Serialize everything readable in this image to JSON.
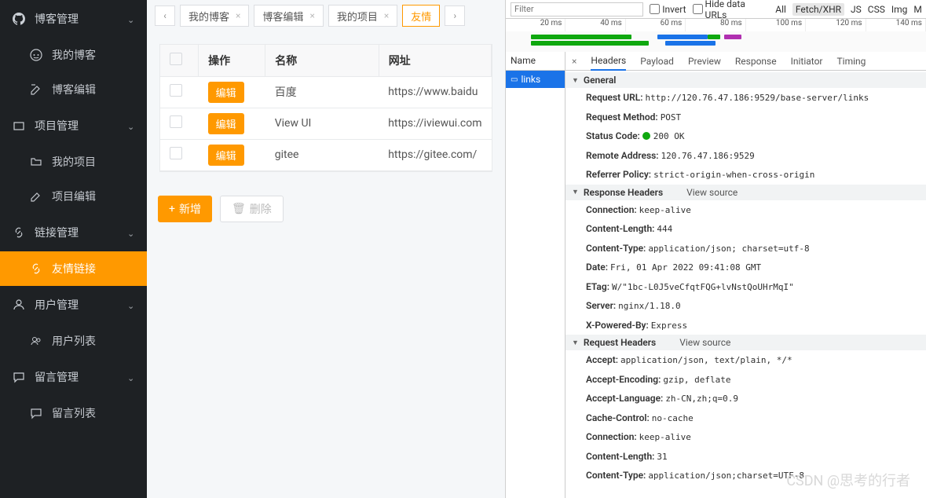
{
  "sidebar": {
    "groups": [
      {
        "label": "博客管理",
        "items": [
          {
            "label": "我的博客"
          },
          {
            "label": "博客编辑"
          }
        ]
      },
      {
        "label": "项目管理",
        "items": [
          {
            "label": "我的项目"
          },
          {
            "label": "项目编辑"
          }
        ]
      },
      {
        "label": "链接管理",
        "items": [
          {
            "label": "友情链接",
            "active": true
          }
        ]
      },
      {
        "label": "用户管理",
        "items": [
          {
            "label": "用户列表"
          }
        ]
      },
      {
        "label": "留言管理",
        "items": [
          {
            "label": "留言列表"
          }
        ]
      }
    ]
  },
  "tabs": {
    "prev": "‹",
    "next": "›",
    "items": [
      {
        "label": "我的博客",
        "close": "×"
      },
      {
        "label": "博客编辑",
        "close": "×"
      },
      {
        "label": "我的项目",
        "close": "×"
      },
      {
        "label": "友情",
        "close": "",
        "active": true
      }
    ]
  },
  "table": {
    "headers": {
      "op": "操作",
      "name": "名称",
      "url": "网址"
    },
    "edit_label": "编辑",
    "rows": [
      {
        "name": "百度",
        "url": "https://www.baidu"
      },
      {
        "name": "View UI",
        "url": "https://iviewui.com"
      },
      {
        "name": "gitee",
        "url": "https://gitee.com/"
      }
    ]
  },
  "buttons": {
    "add": "新增",
    "add_plus": "+",
    "del": "删除"
  },
  "devtools": {
    "filter_placeholder": "Filter",
    "invert": "Invert",
    "hide_data_urls": "Hide data URLs",
    "types": [
      "All",
      "Fetch/XHR",
      "JS",
      "CSS",
      "Img",
      "M"
    ],
    "types_selected": "Fetch/XHR",
    "timeline_ticks": [
      "20 ms",
      "40 ms",
      "60 ms",
      "80 ms",
      "100 ms",
      "120 ms",
      "140 ms"
    ],
    "name_header": "Name",
    "requests": [
      {
        "name": "links"
      }
    ],
    "detail_tabs": [
      "Headers",
      "Payload",
      "Preview",
      "Response",
      "Initiator",
      "Timing"
    ],
    "detail_active": "Headers",
    "close_x": "×",
    "general_label": "General",
    "general": [
      {
        "k": "Request URL:",
        "v": "http://120.76.47.186:9529/base-server/links"
      },
      {
        "k": "Request Method:",
        "v": "POST"
      },
      {
        "k": "Status Code:",
        "v": "200 OK",
        "status": true
      },
      {
        "k": "Remote Address:",
        "v": "120.76.47.186:9529"
      },
      {
        "k": "Referrer Policy:",
        "v": "strict-origin-when-cross-origin"
      }
    ],
    "response_headers_label": "Response Headers",
    "view_source": "View source",
    "response_headers": [
      {
        "k": "Connection:",
        "v": "keep-alive"
      },
      {
        "k": "Content-Length:",
        "v": "444"
      },
      {
        "k": "Content-Type:",
        "v": "application/json; charset=utf-8"
      },
      {
        "k": "Date:",
        "v": "Fri, 01 Apr 2022 09:41:08 GMT"
      },
      {
        "k": "ETag:",
        "v": "W/\"1bc-L0J5veCfqtFQG+lvNstQoUHrMqI\""
      },
      {
        "k": "Server:",
        "v": "nginx/1.18.0"
      },
      {
        "k": "X-Powered-By:",
        "v": "Express"
      }
    ],
    "request_headers_label": "Request Headers",
    "request_headers": [
      {
        "k": "Accept:",
        "v": "application/json, text/plain, */*"
      },
      {
        "k": "Accept-Encoding:",
        "v": "gzip, deflate"
      },
      {
        "k": "Accept-Language:",
        "v": "zh-CN,zh;q=0.9"
      },
      {
        "k": "Cache-Control:",
        "v": "no-cache"
      },
      {
        "k": "Connection:",
        "v": "keep-alive"
      },
      {
        "k": "Content-Length:",
        "v": "31"
      },
      {
        "k": "Content-Type:",
        "v": "application/json;charset=UTF-8"
      }
    ]
  },
  "watermark": "CSDN @思考的行者"
}
